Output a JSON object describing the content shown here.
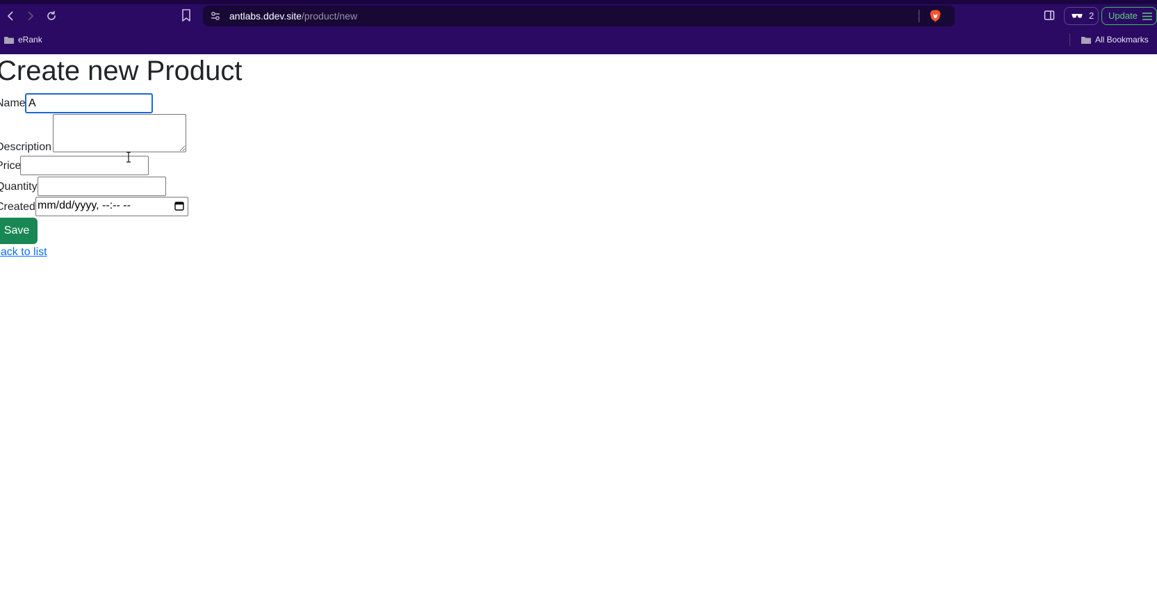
{
  "browser": {
    "url_host": "antlabs.ddev.site",
    "url_path": "/product/new",
    "wallet_count": "2",
    "update_label": "Update",
    "bookmarks_bar": {
      "left_item": "eRank",
      "right_item": "All Bookmarks"
    }
  },
  "page": {
    "title": "Create new Product",
    "form": {
      "name_label": "Name",
      "name_value": "A",
      "description_label": "Description",
      "description_value": "",
      "price_label": "Price",
      "price_value": "",
      "quantity_label": "Quantity",
      "quantity_value": "",
      "created_label": "Created",
      "created_placeholder": "mm/dd/yyyy, --:-- --",
      "save_label": "Save"
    },
    "back_link": "back to list"
  },
  "colors": {
    "chrome_bg": "#2a0a63",
    "urlbar_bg": "#180836",
    "save_button": "#198754",
    "link": "#0d6efd",
    "focus_ring": "#1a66d6",
    "update_accent": "#5fd07c"
  },
  "icons": {
    "nav": [
      "back-arrow-icon",
      "forward-arrow-icon",
      "reload-icon",
      "bookmark-icon"
    ],
    "urlbar": [
      "site-settings-icon",
      "brave-lion-icon"
    ],
    "toolbar": [
      "sidebar-icon",
      "glasses-icon",
      "hamburger-menu-icon"
    ],
    "bookmarks": [
      "folder-icon"
    ],
    "form": [
      "calendar-icon"
    ]
  }
}
